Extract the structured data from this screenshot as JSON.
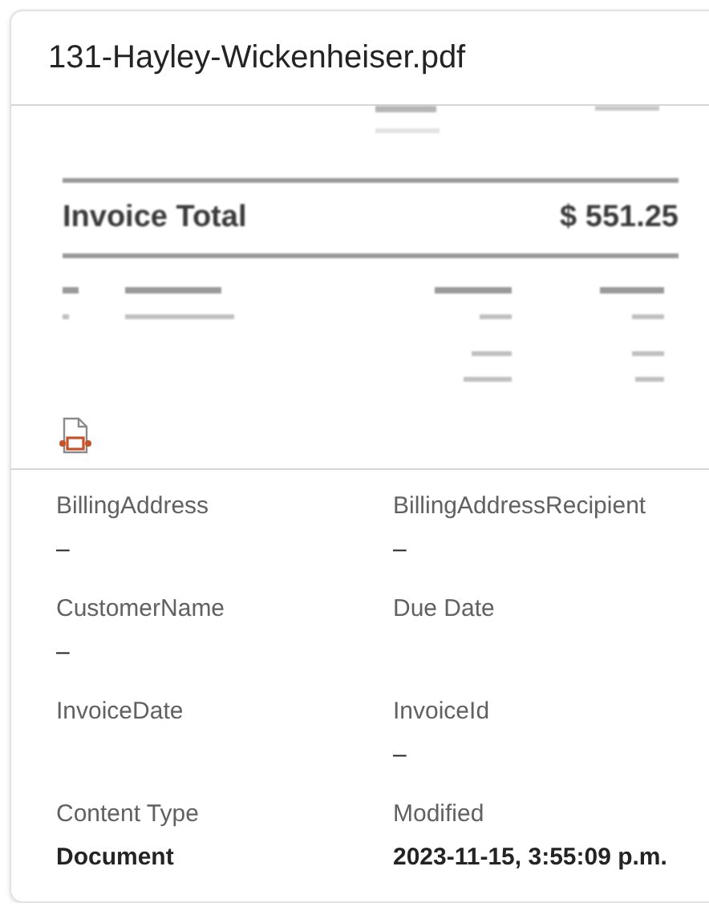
{
  "file_name": "131-Hayley-Wickenheiser.pdf",
  "preview": {
    "total_label": "Invoice Total",
    "total_amount": "$ 551.25"
  },
  "fields": [
    {
      "label": "BillingAddress",
      "value": "–"
    },
    {
      "label": "BillingAddressRecipient",
      "value": "–"
    },
    {
      "label": "CustomerName",
      "value": "–"
    },
    {
      "label": "Due Date"
    },
    {
      "label": "InvoiceDate"
    },
    {
      "label": "InvoiceId",
      "value": "–"
    },
    {
      "label": "Content Type",
      "value": "Document",
      "strong": true
    },
    {
      "label": "Modified",
      "value": "2023-11-15, 3:55:09 p.m.",
      "strong": true
    }
  ]
}
